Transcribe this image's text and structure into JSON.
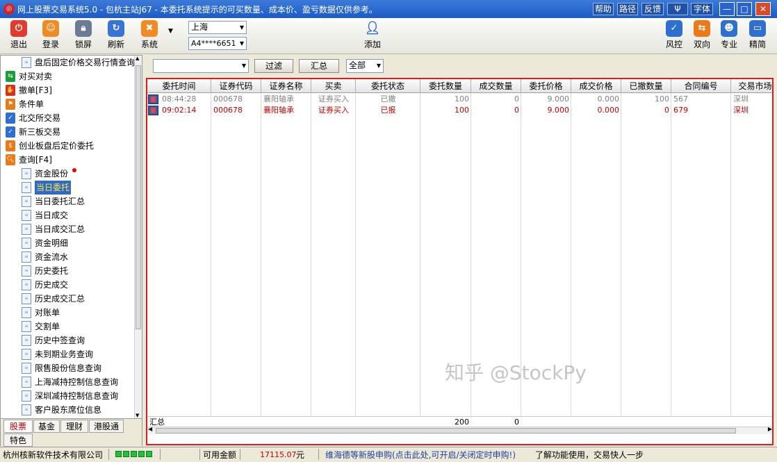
{
  "window": {
    "title": "网上股票交易系统5.0 - 包杭主站J67 - 本委托系统提示的可买数量、成本价、盈亏数据仅供参考。",
    "buttons": [
      "帮助",
      "路径",
      "反馈",
      "Ψ",
      "字体"
    ],
    "controls": [
      "—",
      "□",
      "✕"
    ]
  },
  "toolbar": {
    "items": [
      {
        "label": "退出",
        "icon": "power-icon",
        "color": "#e23b2e"
      },
      {
        "label": "登录",
        "icon": "user-login-icon",
        "color": "#f08a24"
      },
      {
        "label": "锁屏",
        "icon": "lock-icon",
        "color": "#6b7b93"
      },
      {
        "label": "刷新",
        "icon": "refresh-icon",
        "color": "#3874d8"
      },
      {
        "label": "系统",
        "icon": "tools-icon",
        "color": "#f08a24"
      }
    ],
    "market": "上海",
    "account": "A4****6651",
    "add_label": "添加",
    "right_items": [
      {
        "label": "风控",
        "icon": "shield-icon",
        "color": "#2e6fd0"
      },
      {
        "label": "双向",
        "icon": "swap-arrows-icon",
        "color": "#e87a1a"
      },
      {
        "label": "专业",
        "icon": "person-icon",
        "color": "#2e6fd0"
      },
      {
        "label": "精简",
        "icon": "chat-icon",
        "color": "#2e6fd0"
      }
    ]
  },
  "sidebar": {
    "items": [
      {
        "label": "盘后固定价格交易行情查询",
        "level": 2
      },
      {
        "label": "对买对卖",
        "level": 1,
        "icon_color": "#1f9a3a"
      },
      {
        "label": "撤单[F3]",
        "level": 1,
        "icon_color": "#d83020"
      },
      {
        "label": "条件单",
        "level": 1,
        "icon_color": "#e87a1a"
      },
      {
        "label": "北交所交易",
        "level": 1,
        "icon_color": "#2e6fd0"
      },
      {
        "label": "新三板交易",
        "level": 1,
        "icon_color": "#2e6fd0"
      },
      {
        "label": "创业板盘后定价委托",
        "level": 1,
        "icon_color": "#e87a1a"
      },
      {
        "label": "查询[F4]",
        "level": 1,
        "icon_color": "#e87a1a"
      },
      {
        "label": "资金股份",
        "level": 2
      },
      {
        "label": "当日委托",
        "level": 2
      },
      {
        "label": "当日委托汇总",
        "level": 2
      },
      {
        "label": "当日成交",
        "level": 2
      },
      {
        "label": "当日成交汇总",
        "level": 2
      },
      {
        "label": "资金明细",
        "level": 2
      },
      {
        "label": "资金流水",
        "level": 2
      },
      {
        "label": "历史委托",
        "level": 2
      },
      {
        "label": "历史成交",
        "level": 2
      },
      {
        "label": "历史成交汇总",
        "level": 2
      },
      {
        "label": "对账单",
        "level": 2
      },
      {
        "label": "交割单",
        "level": 2
      },
      {
        "label": "历史中签查询",
        "level": 2
      },
      {
        "label": "未到期业务查询",
        "level": 2
      },
      {
        "label": "限售股份信息查询",
        "level": 2
      },
      {
        "label": "上海减持控制信息查询",
        "level": 2
      },
      {
        "label": "深圳减持控制信息查询",
        "level": 2
      },
      {
        "label": "客户股东席位信息",
        "level": 2
      }
    ],
    "selected_index": 9,
    "tabs": [
      "股票",
      "基金",
      "理财",
      "港股通",
      "特色"
    ]
  },
  "filter": {
    "dropdown_value": "",
    "filter_button": "过滤",
    "summary_button": "汇总",
    "scope_value": "全部"
  },
  "table": {
    "columns": [
      "委托时间",
      "证券代码",
      "证券名称",
      "买卖",
      "委托状态",
      "委托数量",
      "成交数量",
      "委托价格",
      "成交价格",
      "已撤数量",
      "合同编号",
      "交易市场"
    ],
    "rows": [
      [
        "08:44:28",
        "000678",
        "襄阳轴承",
        "证券买入",
        "已撤",
        "100",
        "0",
        "9.000",
        "0.000",
        "100",
        "567",
        "深圳"
      ],
      [
        "09:02:14",
        "000678",
        "襄阳轴承",
        "证券买入",
        "已报",
        "100",
        "0",
        "9.000",
        "0.000",
        "0",
        "679",
        "深圳"
      ]
    ],
    "summary_label": "汇总",
    "summary_qty": "200",
    "summary_filled": "0"
  },
  "watermark": "知乎 @StockPy",
  "status": {
    "company": "杭州核新软件技术有限公司",
    "available_label": "可用金额",
    "available_value": "17115.07",
    "currency": "元",
    "notice": "维海德等新股申购(点击此处,可开启/关闭定时申购!)",
    "tip": "了解功能使用，交易快人一步"
  }
}
